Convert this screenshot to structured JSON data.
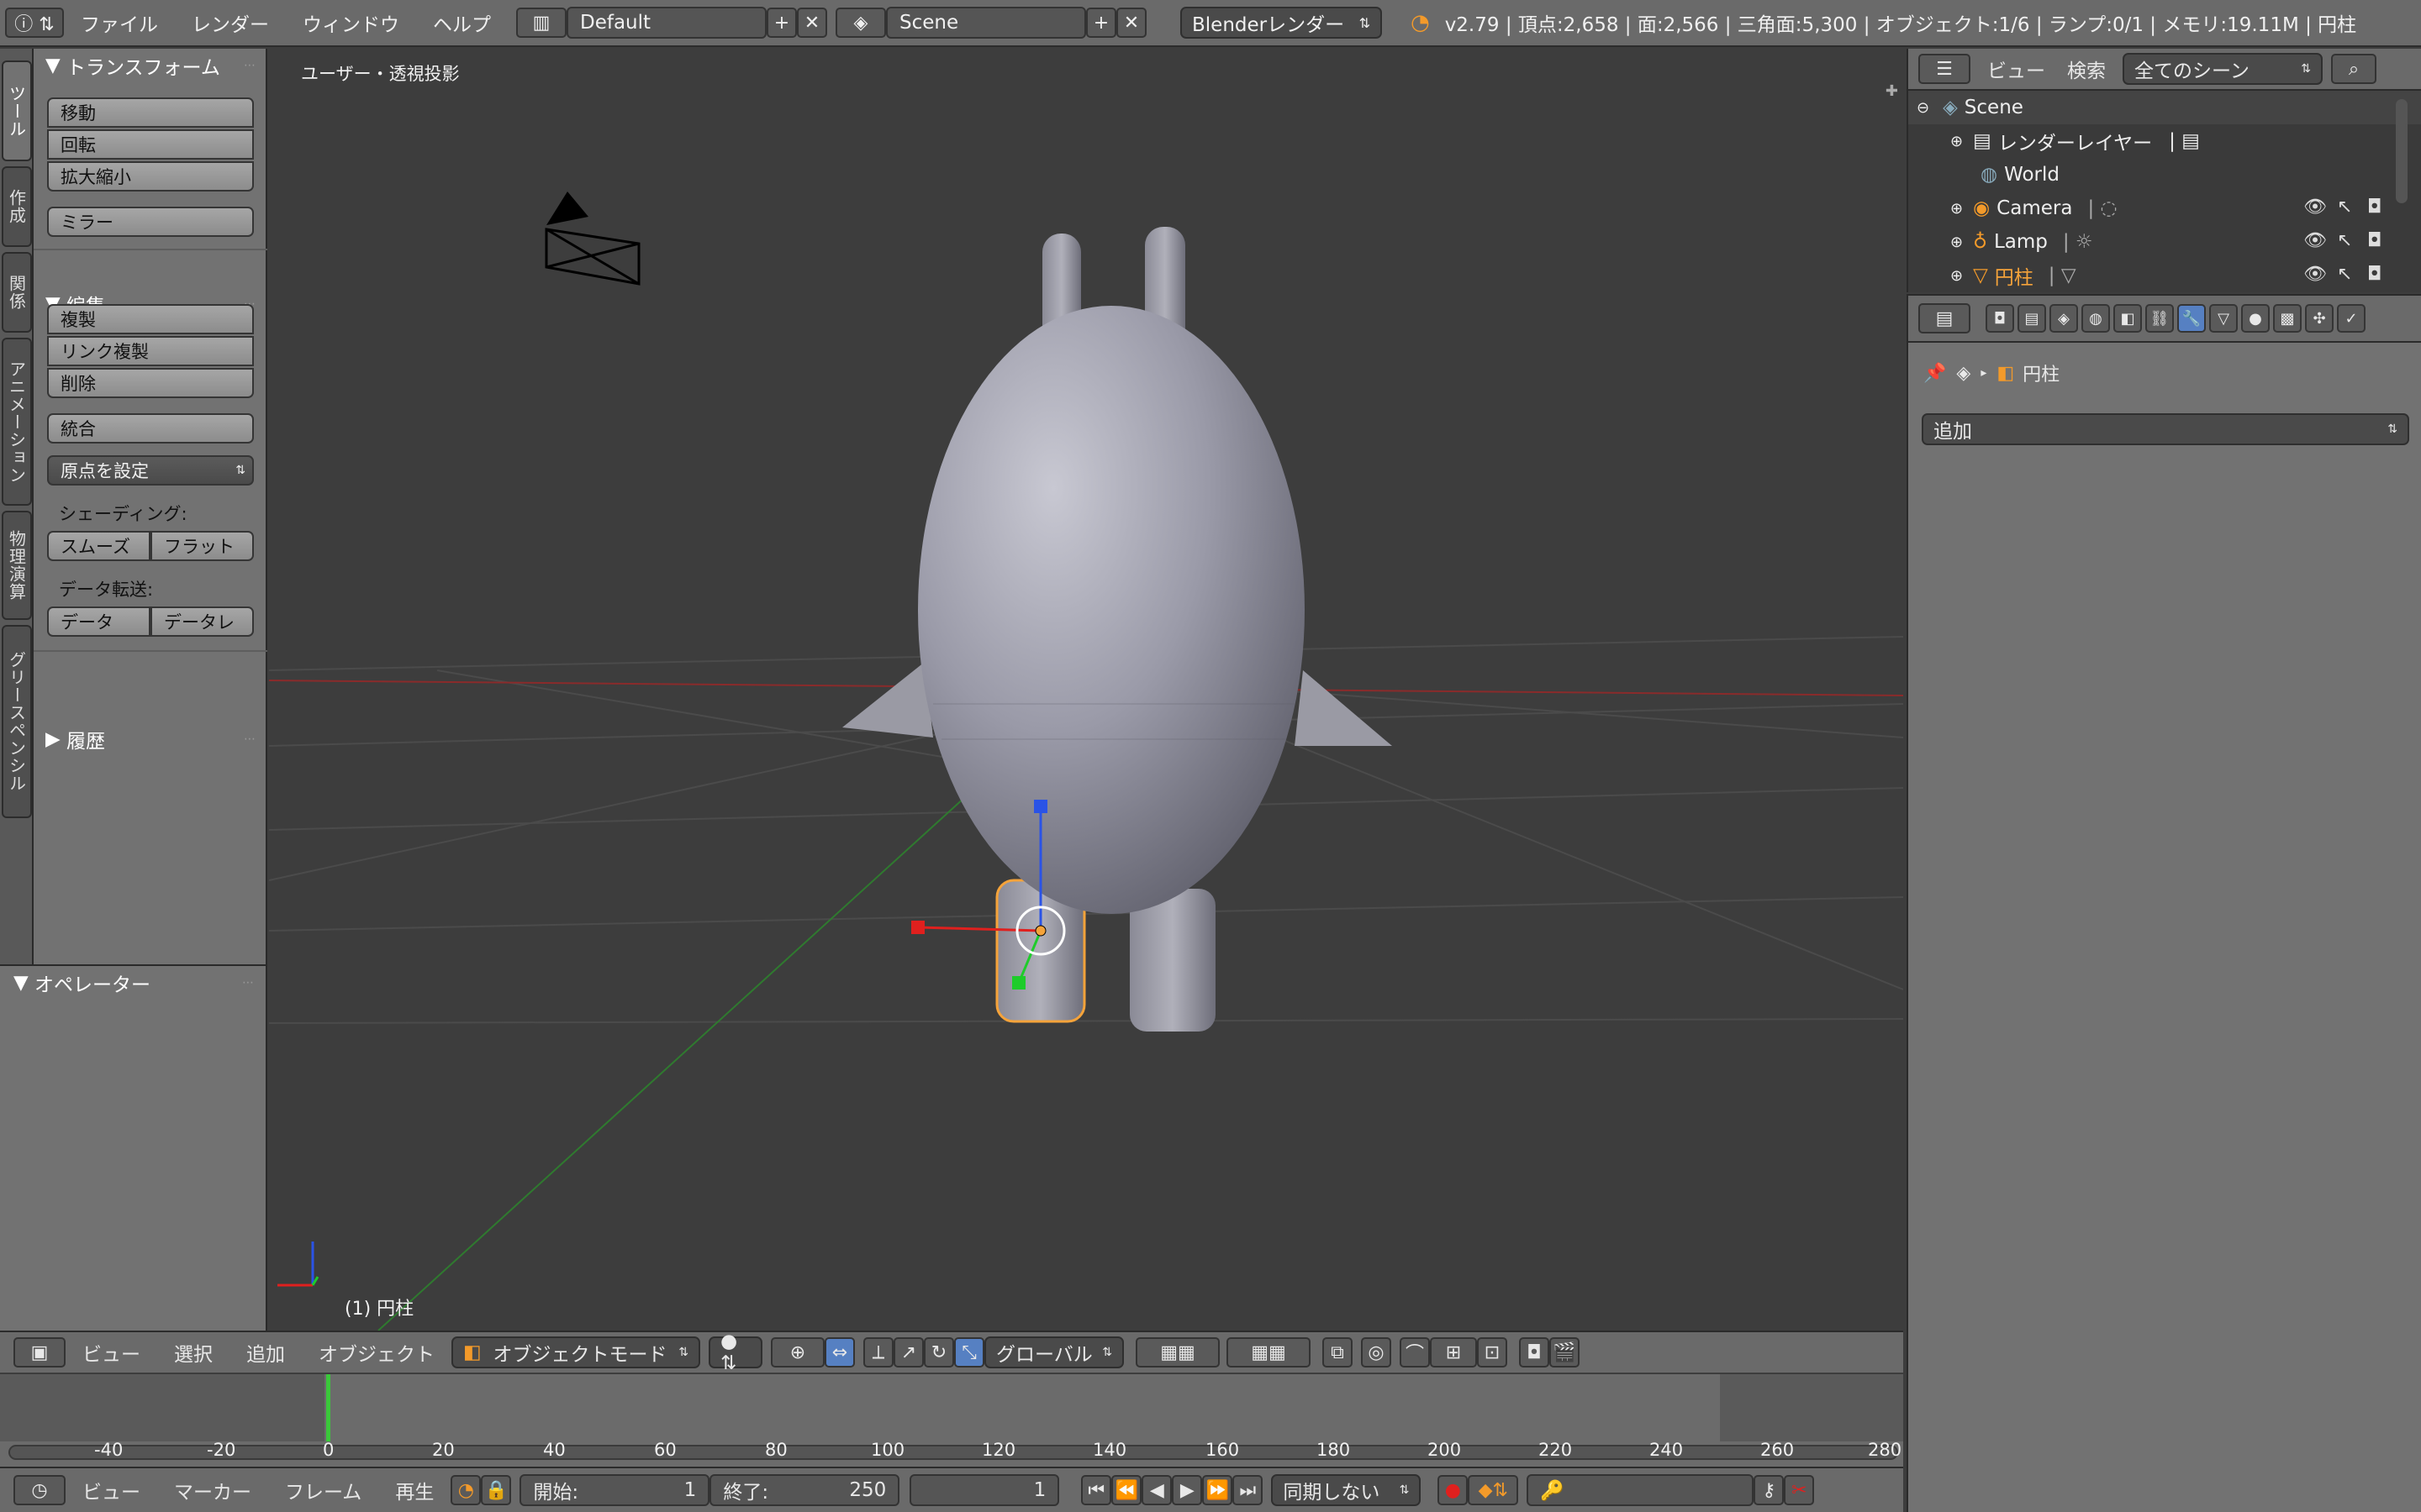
{
  "menu": {
    "file": "ファイル",
    "render": "レンダー",
    "window": "ウィンドウ",
    "help": "ヘルプ"
  },
  "layout_name": "Default",
  "scene_name": "Scene",
  "engine": "Blenderレンダー",
  "stats": "v2.79 | 頂点:2,658 | 面:2,566 | 三角面:5,300 | オブジェクト:1/6 | ランプ:0/1 | メモリ:19.11M | 円柱",
  "tool_tabs": [
    "ツール",
    "作成",
    "関係",
    "アニメーション",
    "物理演算",
    "グリースペンシル"
  ],
  "tool_shelf": {
    "transform_title": "トランスフォーム",
    "move": "移動",
    "rotate": "回転",
    "scale": "拡大縮小",
    "mirror": "ミラー",
    "edit_title": "編集",
    "duplicate": "複製",
    "link_duplicate": "リンク複製",
    "delete": "削除",
    "join": "統合",
    "set_origin": "原点を設定",
    "shading_label": "シェーディング:",
    "smooth": "スムーズ",
    "flat": "フラット",
    "data_transfer_label": "データ転送:",
    "data": "データ",
    "data_layout": "データレ",
    "history_title": "履歴",
    "operator_title": "オペレーター"
  },
  "viewport": {
    "view_label": "ユーザー・透視投影",
    "object_label": "(1) 円柱"
  },
  "view3d_header": {
    "view": "ビュー",
    "select": "選択",
    "add": "追加",
    "object": "オブジェクト",
    "mode": "オブジェクトモード",
    "orientation": "グローバル"
  },
  "timeline": {
    "ticks": [
      "-40",
      "-20",
      "0",
      "20",
      "40",
      "60",
      "80",
      "100",
      "120",
      "140",
      "160",
      "180",
      "200",
      "220",
      "240",
      "260",
      "280"
    ],
    "current_frame_pos": 0
  },
  "timeline_header": {
    "view": "ビュー",
    "marker": "マーカー",
    "frame": "フレーム",
    "playback": "再生",
    "start_label": "開始:",
    "start": "1",
    "end_label": "終了:",
    "end": "250",
    "current": "1",
    "sync": "同期しない"
  },
  "outliner": {
    "view": "ビュー",
    "search": "検索",
    "filter": "全てのシーン",
    "rows": [
      {
        "name": "Scene"
      },
      {
        "name": "レンダーレイヤー"
      },
      {
        "name": "World"
      },
      {
        "name": "Camera"
      },
      {
        "name": "Lamp"
      },
      {
        "name": "円柱"
      }
    ]
  },
  "properties": {
    "breadcrumb_object": "円柱",
    "add_modifier": "追加"
  },
  "colors": {
    "accent": "#5680c2",
    "selection": "#f5a33a",
    "x_axis": "#e0201e",
    "y_axis": "#1ecc2a",
    "z_axis": "#2a53e6"
  }
}
